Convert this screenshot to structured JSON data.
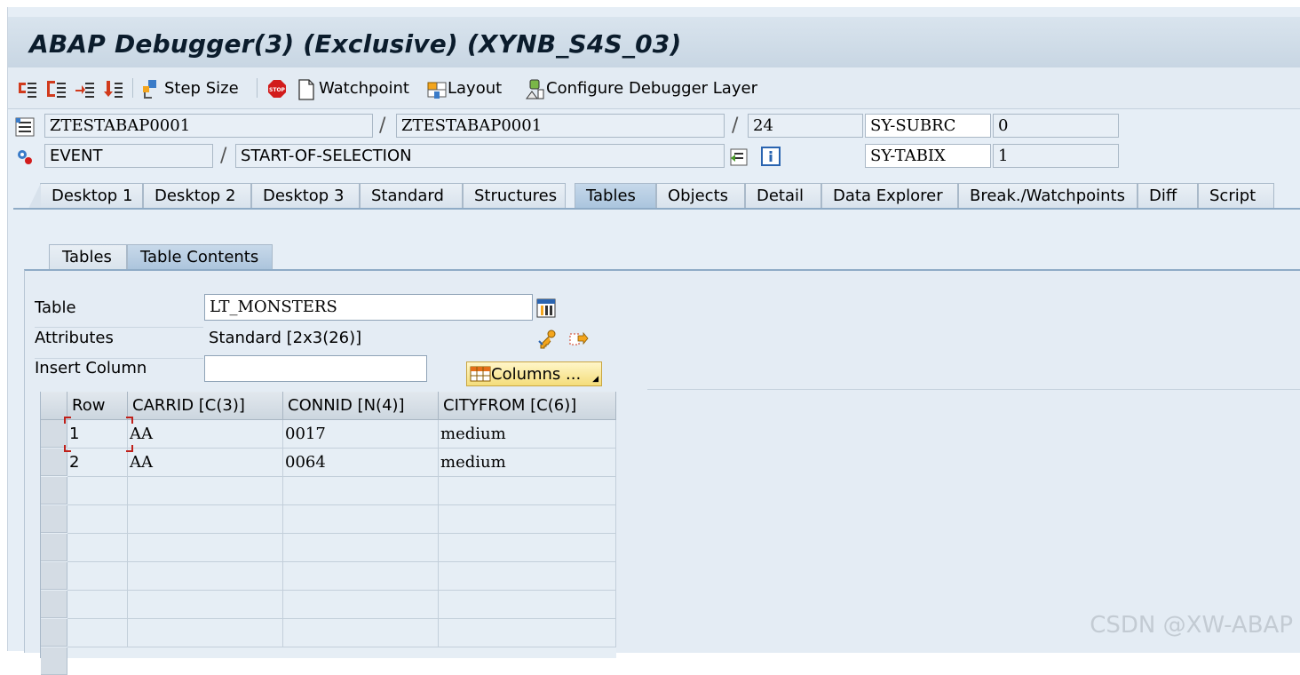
{
  "window": {
    "title": "ABAP Debugger(3)  (Exclusive) (XYNB_S4S_03)"
  },
  "toolbar": {
    "step_icons": [
      "step-into-icon",
      "step-over-icon",
      "step-return-icon",
      "continue-icon"
    ],
    "step_size": "Step Size",
    "watchpoint": "Watchpoint",
    "layout": "Layout",
    "configure": "Configure Debugger Layer"
  },
  "header": {
    "program": "ZTESTABAP0001",
    "include": "ZTESTABAP0001",
    "line": "24",
    "event_type": "EVENT",
    "event_name": "START-OF-SELECTION",
    "sysvars": [
      {
        "name": "SY-SUBRC",
        "value": "0"
      },
      {
        "name": "SY-TABIX",
        "value": "1"
      }
    ]
  },
  "tabs": [
    "Desktop 1",
    "Desktop 2",
    "Desktop 3",
    "Standard",
    "Structures",
    "Tables",
    "Objects",
    "Detail",
    "Data Explorer",
    "Break./Watchpoints",
    "Diff",
    "Script"
  ],
  "active_tab": "Tables",
  "subtabs": [
    "Tables",
    "Table Contents"
  ],
  "active_subtab": "Table Contents",
  "table_panel": {
    "table_label": "Table",
    "table_value": "LT_MONSTERS",
    "attributes_label": "Attributes",
    "attributes_value": "Standard [2x3(26)]",
    "insert_column_label": "Insert Column",
    "insert_column_value": "",
    "columns_button": "Columns ..."
  },
  "grid": {
    "headers": [
      "Row",
      "CARRID [C(3)]",
      "CONNID [N(4)]",
      "CITYFROM [C(6)]"
    ],
    "rows": [
      [
        "1",
        "AA",
        "0017",
        "medium"
      ],
      [
        "2",
        "AA",
        "0064",
        "medium"
      ]
    ]
  },
  "watermark": "CSDN @XW-ABAP",
  "colors": {
    "title_bar": "#c8d6e3",
    "active_tab": "#aac4dd",
    "columns_button": "#f4dd7a",
    "stop_red": "#d21c1c"
  }
}
